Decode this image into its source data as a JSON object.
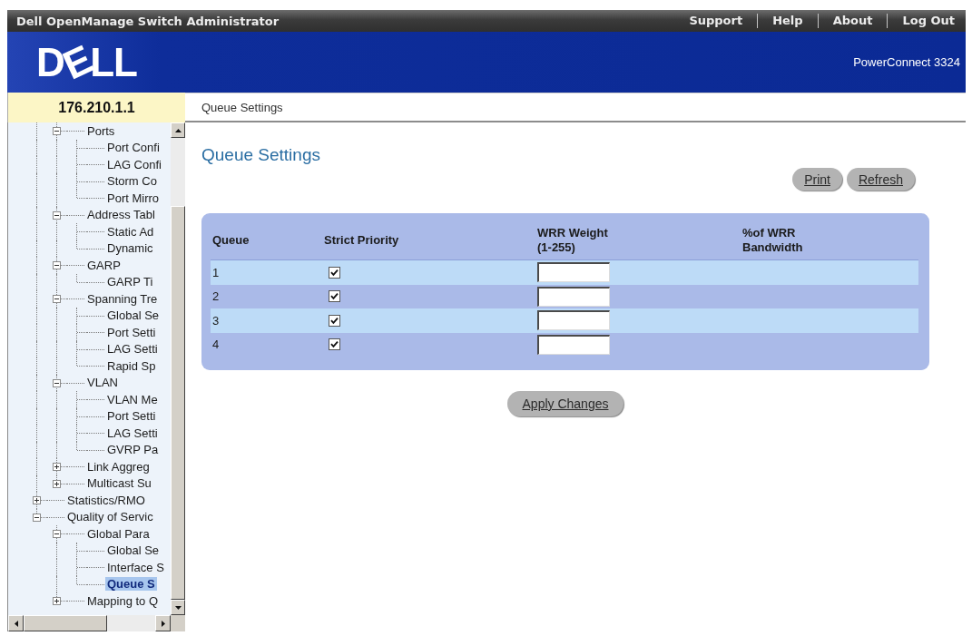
{
  "header": {
    "title": "Dell OpenManage Switch Administrator",
    "links": [
      "Support",
      "Help",
      "About",
      "Log Out"
    ]
  },
  "banner": {
    "logo": "DELL",
    "product": "PowerConnect 3324"
  },
  "location": {
    "device_address": "176.210.1.1",
    "breadcrumb": "Queue Settings"
  },
  "sidebar": {
    "tree": [
      {
        "children": [
          {
            "label": "Ports",
            "expanded": true,
            "selected": false,
            "children": [
              {
                "label": "Port Confi",
                "selected": false
              },
              {
                "label": "LAG Confi",
                "selected": false
              },
              {
                "label": "Storm Co",
                "selected": false
              },
              {
                "label": "Port Mirro",
                "selected": false
              }
            ]
          },
          {
            "label": "Address Tabl",
            "expanded": true,
            "selected": false,
            "children": [
              {
                "label": "Static Ad",
                "selected": false
              },
              {
                "label": "Dynamic",
                "selected": false
              }
            ]
          },
          {
            "label": "GARP",
            "expanded": true,
            "selected": false,
            "children": [
              {
                "label": "GARP Ti",
                "selected": false
              }
            ]
          },
          {
            "label": "Spanning Tre",
            "expanded": true,
            "selected": false,
            "children": [
              {
                "label": "Global Se",
                "selected": false
              },
              {
                "label": "Port Setti",
                "selected": false
              },
              {
                "label": "LAG Setti",
                "selected": false
              },
              {
                "label": "Rapid Sp",
                "selected": false
              }
            ]
          },
          {
            "label": "VLAN",
            "expanded": true,
            "selected": false,
            "children": [
              {
                "label": "VLAN Me",
                "selected": false
              },
              {
                "label": "Port Setti",
                "selected": false
              },
              {
                "label": "LAG Setti",
                "selected": false
              },
              {
                "label": "GVRP Pa",
                "selected": false
              }
            ]
          },
          {
            "label": "Link Aggreg",
            "expanded": false,
            "selected": false
          },
          {
            "label": "Multicast Su",
            "expanded": false,
            "selected": false
          }
        ]
      },
      {
        "label": "Statistics/RMO",
        "expanded": false,
        "selected": false
      },
      {
        "label": "Quality of Servic",
        "expanded": true,
        "selected": false,
        "children": [
          {
            "label": "Global Para",
            "expanded": true,
            "selected": false,
            "children": [
              {
                "label": "Global Se",
                "selected": false
              },
              {
                "label": "Interface S",
                "selected": false
              },
              {
                "label": "Queue S",
                "selected": true
              }
            ]
          },
          {
            "label": "Mapping to Q",
            "expanded": false,
            "selected": false
          }
        ]
      }
    ]
  },
  "content": {
    "title": "Queue Settings",
    "buttons": [
      "Print",
      "Refresh"
    ],
    "table": {
      "columns": [
        "Queue",
        "Strict Priority",
        "WRR Weight (1-255)",
        "%of WRR Bandwidth"
      ],
      "rows": [
        {
          "queue": "1",
          "strict_priority": true
        },
        {
          "queue": "2",
          "strict_priority": true
        },
        {
          "queue": "3",
          "strict_priority": true
        },
        {
          "queue": "4",
          "strict_priority": true
        }
      ]
    },
    "apply_button": "Apply Changes"
  }
}
